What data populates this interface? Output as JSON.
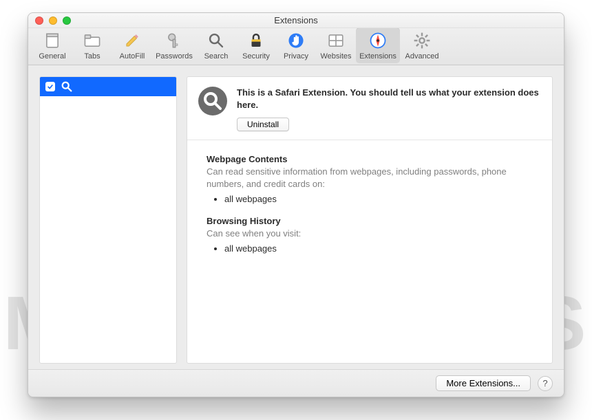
{
  "window": {
    "title": "Extensions"
  },
  "toolbar": {
    "items": [
      {
        "id": "general",
        "label": "General"
      },
      {
        "id": "tabs",
        "label": "Tabs"
      },
      {
        "id": "autofill",
        "label": "AutoFill"
      },
      {
        "id": "passwords",
        "label": "Passwords"
      },
      {
        "id": "search",
        "label": "Search"
      },
      {
        "id": "security",
        "label": "Security"
      },
      {
        "id": "privacy",
        "label": "Privacy"
      },
      {
        "id": "websites",
        "label": "Websites"
      },
      {
        "id": "extensions",
        "label": "Extensions"
      },
      {
        "id": "advanced",
        "label": "Advanced"
      }
    ],
    "selected": "extensions"
  },
  "sidebar": {
    "items": [
      {
        "checked": true,
        "icon": "magnifier-icon",
        "name": ""
      }
    ]
  },
  "detail": {
    "description": "This is a Safari Extension. You should tell us what your extension does here.",
    "uninstall_label": "Uninstall",
    "sections": [
      {
        "heading": "Webpage Contents",
        "body": "Can read sensitive information from webpages, including passwords, phone numbers, and credit cards on:",
        "items": [
          "all webpages"
        ]
      },
      {
        "heading": "Browsing History",
        "body": "Can see when you visit:",
        "items": [
          "all webpages"
        ]
      }
    ]
  },
  "footer": {
    "more_label": "More Extensions...",
    "help_label": "?"
  },
  "watermark": "MALWARETIPS"
}
